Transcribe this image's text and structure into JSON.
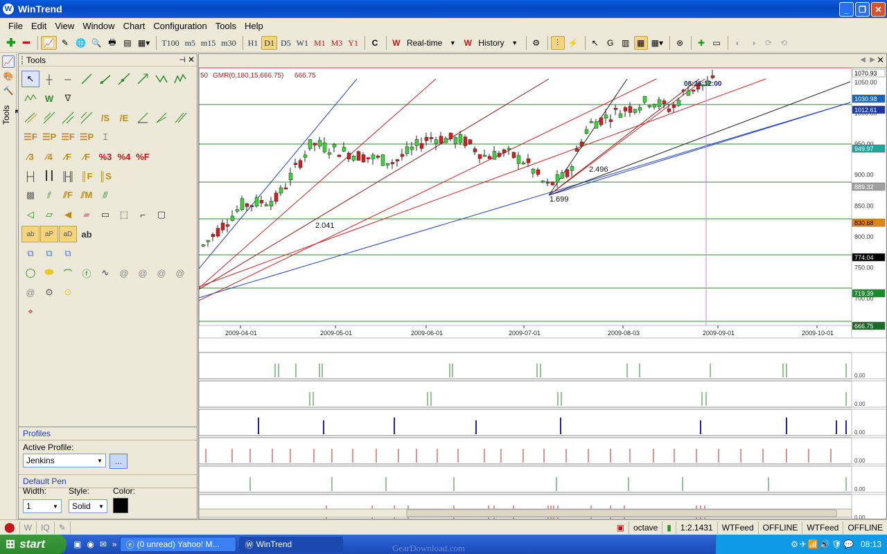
{
  "window": {
    "title": "WinTrend",
    "icon": "app-logo-icon"
  },
  "menu": [
    "File",
    "Edit",
    "View",
    "Window",
    "Chart",
    "Configuration",
    "Tools",
    "Help"
  ],
  "toolbar": {
    "timeframes": [
      "T100",
      "m5",
      "m15",
      "m30",
      "H1",
      "D1",
      "D5",
      "W1",
      "M1",
      "M3",
      "Y1"
    ],
    "active_timeframe": "D1",
    "realtime_label": "Real-time",
    "history_label": "History",
    "c_label": "C"
  },
  "sidebar": {
    "vertical_tab": "Tools"
  },
  "tools_panel": {
    "title": "Tools",
    "text_tool_label": "ab"
  },
  "profiles": {
    "section_title": "Profiles",
    "active_profile_label": "Active Profile:",
    "active_profile_value": "Jenkins",
    "more_button": "...",
    "pen_section_title": "Default Pen",
    "width_label": "Width:",
    "style_label": "Style:",
    "color_label": "Color:",
    "width_value": "1",
    "style_value": "Solid",
    "pen_color": "#000000"
  },
  "chart": {
    "indicator_prefix": "50",
    "indicator_text": "GMR(0,180,15,666.75)",
    "indicator_value": "666.75",
    "crosshair_time": "08:26:12:00",
    "date_labels": [
      "2009-04-01",
      "2009-05-01",
      "2009-06-01",
      "2009-07-01",
      "2009-08-03",
      "2009-09-01",
      "2009-10-01"
    ],
    "price_ticks": [
      "1050.00",
      "1000.00",
      "950.00",
      "900.00",
      "850.00",
      "800.00",
      "750.00",
      "700.00"
    ],
    "price_badges": [
      {
        "label": "1070.93",
        "bg": "#ffffff",
        "fg": "#000000"
      },
      {
        "label": "1030.98",
        "bg": "#1a64b4",
        "fg": "#ffffff"
      },
      {
        "label": "1012.61",
        "bg": "#1a3aa0",
        "fg": "#ffffff"
      },
      {
        "label": "949.97",
        "bg": "#1ba6a0",
        "fg": "#ffffff"
      },
      {
        "label": "889.32",
        "bg": "#a0a0a0",
        "fg": "#ffffff"
      },
      {
        "label": "830.68",
        "bg": "#e0841a",
        "fg": "#000000"
      },
      {
        "label": "774.04",
        "bg": "#000000",
        "fg": "#ffffff"
      },
      {
        "label": "719.39",
        "bg": "#1a8a2a",
        "fg": "#ffffff"
      },
      {
        "label": "666.75",
        "bg": "#1a6a2a",
        "fg": "#ffffff"
      }
    ],
    "annotations": [
      "2.041",
      "1.699",
      "2.496"
    ],
    "subpane_label": "0.00"
  },
  "status": {
    "user": "octave",
    "ratio": "1:2.1431",
    "feed1": "WTFeed",
    "feed1_state": "OFFLINE",
    "feed2": "WTFeed",
    "feed2_state": "OFFLINE"
  },
  "taskbar": {
    "start": "start",
    "tasks": [
      "(0 unread) Yahoo! M...",
      "WinTrend"
    ],
    "clock": "08:13",
    "watermark": "GearDownload.com"
  }
}
